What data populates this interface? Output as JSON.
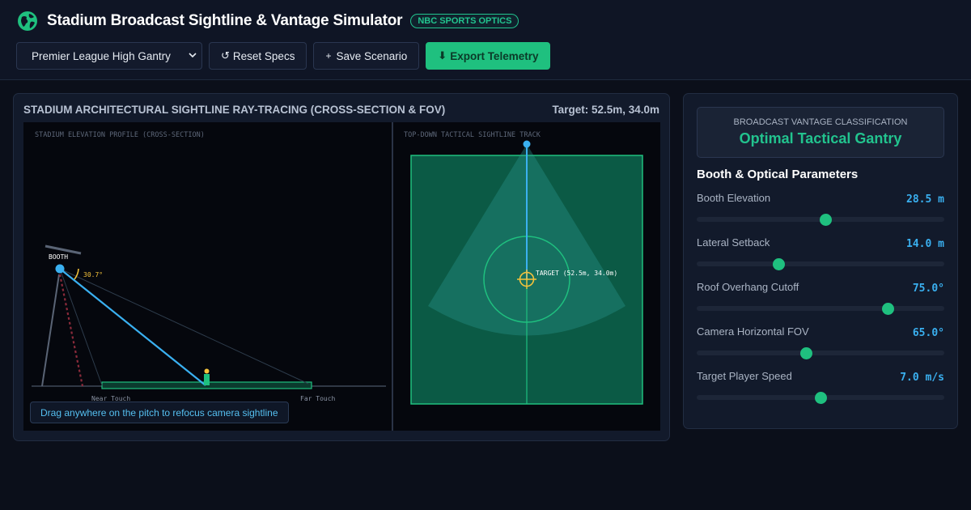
{
  "header": {
    "title": "Stadium Broadcast Sightline & Vantage Simulator",
    "badge": "NBC SPORTS OPTICS",
    "preset_select": {
      "value": "Premier League High Gantry"
    },
    "buttons": {
      "reset": "Reset Specs",
      "save": "Save Scenario",
      "export": "Export Telemetry"
    }
  },
  "visualization": {
    "title": "STADIUM ARCHITECTURAL SIGHTLINE RAY-TRACING (CROSS-SECTION & FOV)",
    "target_readout": "Target: 52.5m, 34.0m",
    "cross_section": {
      "label": "STADIUM ELEVATION PROFILE (CROSS-SECTION)",
      "booth_label": "BOOTH",
      "angle_label": "30.7°",
      "near_touch_label": "Near Touch",
      "far_touch_label": "Far Touch"
    },
    "top_down": {
      "label": "TOP-DOWN TACTICAL SIGHTLINE TRACK",
      "target_label": "TARGET (52.5m, 34.0m)"
    },
    "hint": "Drag anywhere on the pitch to refocus camera sightline"
  },
  "sidebar": {
    "classification_label": "BROADCAST VANTAGE CLASSIFICATION",
    "classification_value": "Optimal Tactical Gantry",
    "params_title": "Booth & Optical Parameters",
    "params": [
      {
        "label": "Booth Elevation",
        "display": "28.5 m",
        "fraction": 0.52
      },
      {
        "label": "Lateral Setback",
        "display": "14.0 m",
        "fraction": 0.33
      },
      {
        "label": "Roof Overhang Cutoff",
        "display": "75.0°",
        "fraction": 0.77
      },
      {
        "label": "Camera Horizontal FOV",
        "display": "65.0°",
        "fraction": 0.44
      },
      {
        "label": "Target Player Speed",
        "display": "7.0 m/s",
        "fraction": 0.5
      }
    ]
  },
  "colors": {
    "accent_green": "#1fc07f",
    "sightline_blue": "#3ab0f0",
    "target_yellow": "#f5c33b",
    "pitch_green": "#0b5a45"
  },
  "icons": {
    "logo": "globe-icon",
    "reset": "refresh-icon",
    "save": "plus-icon",
    "export": "download-icon",
    "target": "crosshair-icon"
  }
}
